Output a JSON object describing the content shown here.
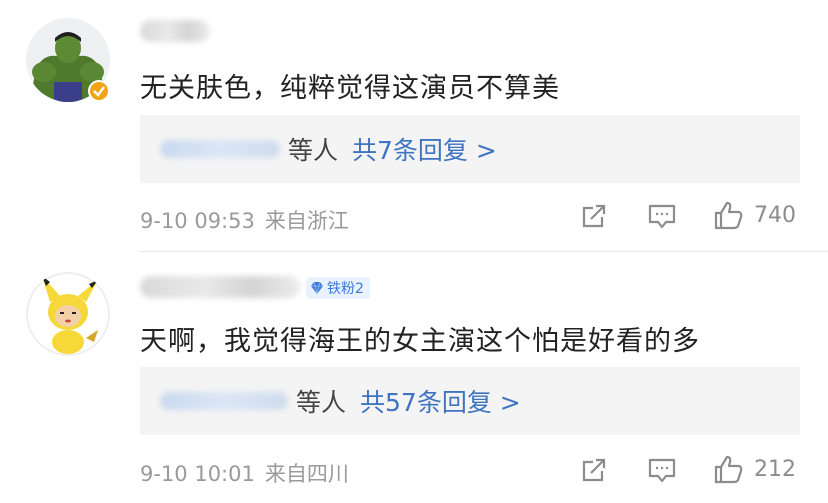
{
  "comments": [
    {
      "avatar_icon": "hulk-avatar-icon",
      "verified_icon": "verified-icon",
      "text": "无关肤色，纯粹觉得这演员不算美",
      "replies": {
        "others": "等人",
        "count": "共7条回复 >"
      },
      "time": "9-10 09:53",
      "location": "来自浙江",
      "like_count": "740"
    },
    {
      "avatar_icon": "pikachu-avatar-icon",
      "badge": {
        "label": "铁粉2",
        "icon": "diamond-icon",
        "color": "#3b78d8"
      },
      "text": "天啊，我觉得海王的女主演这个怕是好看的多",
      "replies": {
        "others": "等人",
        "count": "共57条回复 >"
      },
      "time": "9-10 10:01",
      "location": "来自四川",
      "like_count": "212"
    }
  ],
  "icons": {
    "share": "share-icon",
    "comment": "comment-icon",
    "like": "thumbs-up-icon"
  },
  "colors": {
    "link": "#3f74c2",
    "meta": "#9a9a9a",
    "reply_bg": "#f4f4f4",
    "verified": "#f0a316"
  }
}
